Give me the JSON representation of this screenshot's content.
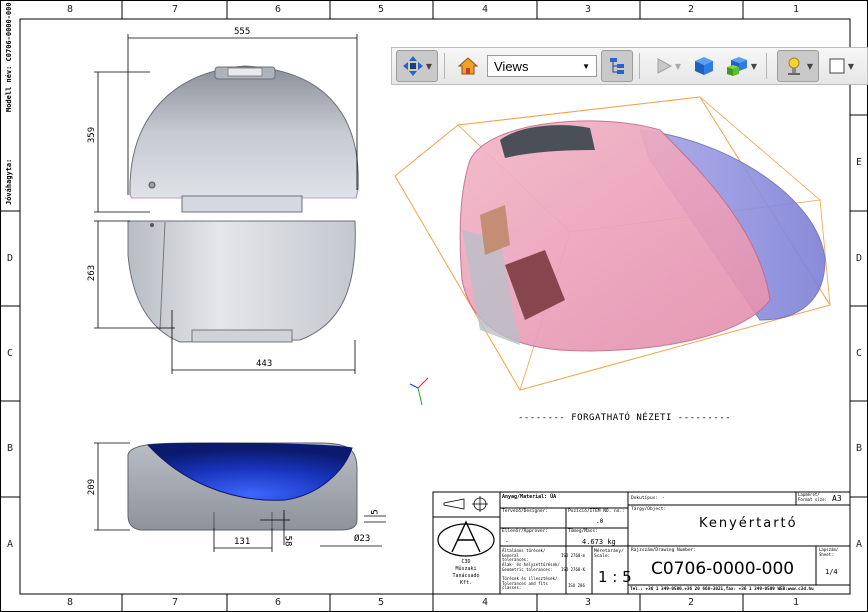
{
  "frame": {
    "zones_top": [
      "8",
      "7",
      "6",
      "5",
      "4",
      "3",
      "2",
      "1"
    ],
    "zones_bottom": [
      "8",
      "7",
      "6",
      "5",
      "4",
      "3",
      "2",
      "1"
    ],
    "zones_left": [
      "D",
      "C",
      "B",
      "A"
    ],
    "zones_right": [
      "E",
      "D",
      "C",
      "B",
      "A"
    ],
    "side_model_label": "Modell név:  C0706-0000-000",
    "side_approved_label": "Jóváhagyta:"
  },
  "toolbar": {
    "views_label": "Views"
  },
  "dimensions": {
    "top_width": "555",
    "top_height": "359",
    "bottom_height": "263",
    "bottom_width": "443",
    "side_height": "209",
    "side_a": "131",
    "side_b": "58",
    "side_c": "5",
    "side_diam": "Ø23"
  },
  "caption": "--------  FORGATHATÓ NÉZETI  ---------",
  "title_block": {
    "material_label": "Anyag/Material: ÜA",
    "designer_label": "Tervező/Designer:",
    "checked_label": "Ellenőr/Approver:",
    "checked_value": "-",
    "pos_label": "Pozíció/ITEM NO. no.:",
    "pos_value": ".0",
    "mass_label": "Tömeg/Mass:",
    "mass_value": "4.673 kg",
    "general_tol_label": "Általános tűrések/ General tolerances:",
    "general_tol_value": "ISO 2768-m",
    "geo_tol_label": "Alak- és helyzettűrések/ Geometric tolerances:",
    "geo_tol_value": "ISO 2768-K",
    "surface_label": "Tűrések és illesztések/ Tolerances and fits classes:",
    "surface_value": "ISO 286",
    "scale_label": "Méretarány/ Scale:",
    "scale_value": "1 : 5",
    "doc_type_label": "Dokutípus:",
    "doc_type_value": "-",
    "format_label": "Lapméret/ Format size:",
    "format_value": "A3",
    "object_label": "Tárgy/Object:",
    "object_value": "Kenyértartó",
    "drawing_no_label": "Rajzszám/Drawing Number:",
    "drawing_no_value": "C0706-0000-000",
    "sheet_label": "Lapszám/ Sheet:",
    "sheet_value": "1/4",
    "company_name": "C3D Műszaki Tanácsadó Kft.",
    "company_line1": "C3D",
    "company_line2": "Műszaki",
    "company_line3": "Tanácsadó",
    "company_line4": "Kft.",
    "contact_line": "Tel.: +36 1 349-0500,+36 20 668-3021,fax: +36 1 349-0509 WEB:www.c3d.hu"
  }
}
